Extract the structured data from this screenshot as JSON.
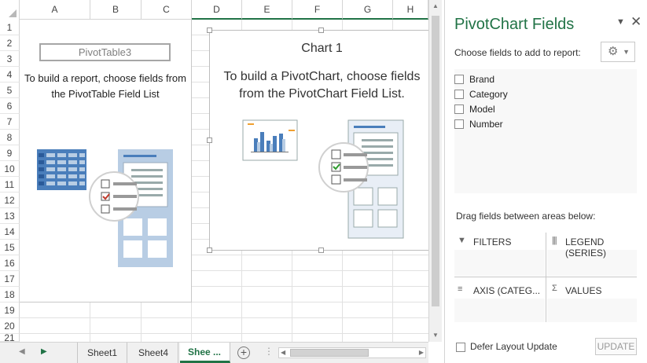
{
  "sheet": {
    "columns": [
      "A",
      "B",
      "C",
      "D",
      "E",
      "F",
      "G",
      "H"
    ],
    "rows": [
      "1",
      "2",
      "3",
      "4",
      "5",
      "6",
      "7",
      "8",
      "9",
      "10",
      "11",
      "12",
      "13",
      "14",
      "15",
      "16",
      "17",
      "18",
      "19",
      "20",
      "21"
    ]
  },
  "pivot_table": {
    "name": "PivotTable3",
    "message": "To build a report, choose fields from the PivotTable Field List"
  },
  "chart": {
    "title": "Chart 1",
    "message": "To build a PivotChart, choose fields from the PivotChart Field List."
  },
  "tabs": {
    "items": [
      "Sheet1",
      "Sheet4",
      "Shee ..."
    ],
    "active_index": 2
  },
  "pane": {
    "title": "PivotChart Fields",
    "choose_label": "Choose fields to add to report:",
    "fields": [
      "Brand",
      "Category",
      "Model",
      "Number"
    ],
    "drag_label": "Drag fields between areas below:",
    "areas": {
      "filters": "FILTERS",
      "legend": "LEGEND (SERIES)",
      "axis": "AXIS (CATEG...",
      "values": "VALUES"
    },
    "defer_label": "Defer Layout Update",
    "update_label": "UPDATE"
  },
  "colors": {
    "accent": "#217346",
    "illustration_blue": "#4a7ebb",
    "illustration_light": "#b8cde4"
  },
  "icons": {
    "pane_close": "close-icon",
    "pane_menu": "chevron-down-icon",
    "tools": "gear-icon",
    "add_sheet": "plus-circle-icon"
  }
}
